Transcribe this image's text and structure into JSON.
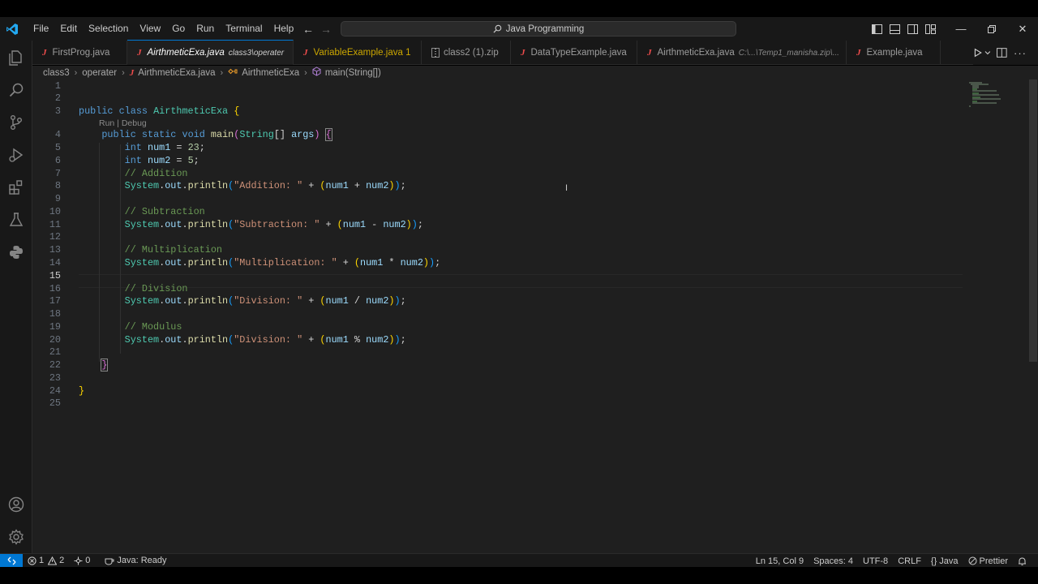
{
  "titlebar": {
    "menu": [
      "File",
      "Edit",
      "Selection",
      "View",
      "Go",
      "Run",
      "Terminal",
      "Help"
    ],
    "search_text": "Java Programming"
  },
  "tabs": [
    {
      "name": "FirstProg.java",
      "desc": "",
      "active": false
    },
    {
      "name": "AirthmeticExa.java",
      "desc": "class3\\operater",
      "active": true
    },
    {
      "name": "VariableExample.java 1",
      "desc": "",
      "active": false
    },
    {
      "name": "class2 (1).zip",
      "desc": "",
      "active": false
    },
    {
      "name": "DataTypeExample.java",
      "desc": "",
      "active": false
    },
    {
      "name": "AirthmeticExa.java",
      "desc": "C:\\...\\Temp1_manisha.zip\\...",
      "active": false
    },
    {
      "name": "Example.java",
      "desc": "",
      "active": false
    }
  ],
  "breadcrumb": {
    "folder1": "class3",
    "folder2": "operater",
    "file": "AirthmeticExa.java",
    "class": "AirthmeticExa",
    "method": "main(String[])"
  },
  "editor": {
    "codelens": "Run | Debug",
    "line_numbers": [
      "1",
      "2",
      "3",
      "4",
      "5",
      "6",
      "7",
      "8",
      "9",
      "10",
      "11",
      "12",
      "13",
      "14",
      "15",
      "16",
      "17",
      "18",
      "19",
      "20",
      "21",
      "22",
      "23",
      "24",
      "25"
    ],
    "current_line": 15,
    "code": [
      "",
      "",
      "public class AirthmeticExa {",
      "    public static void main(String[] args) {",
      "        int num1 = 23;",
      "        int num2 = 5;",
      "        // Addition",
      "        System.out.println(\"Addition: \" + (num1 + num2));",
      "",
      "        // Subtraction",
      "        System.out.println(\"Subtraction: \" + (num1 - num2));",
      "",
      "        // Multiplication",
      "        System.out.println(\"Multiplication: \" + (num1 * num2));",
      "",
      "        // Division",
      "        System.out.println(\"Division: \" + (num1 / num2));",
      "",
      "        // Modulus",
      "        System.out.println(\"Division: \" + (num1 % num2));",
      "",
      "    }",
      "",
      "}",
      ""
    ]
  },
  "statusbar": {
    "errors": "1",
    "warnings": "2",
    "ports": "0",
    "java_status": "Java: Ready",
    "position": "Ln 15, Col 9",
    "spaces": "Spaces: 4",
    "encoding": "UTF-8",
    "eol": "CRLF",
    "language": "Java",
    "formatter": "Prettier"
  },
  "colors": {
    "accent": "#0078d4",
    "editor_bg": "#1f1f1f",
    "chrome_bg": "#181818",
    "java_icon": "#f14c4c",
    "warning_tab": "#cca700"
  }
}
